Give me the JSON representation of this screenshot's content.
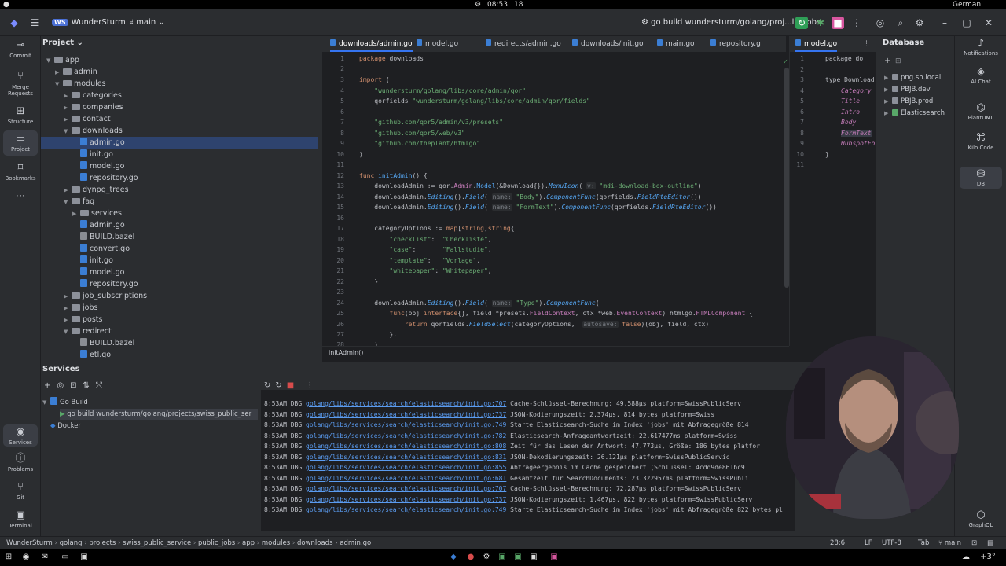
{
  "system": {
    "time": "08:53",
    "notifications": "18",
    "keyboard": "German"
  },
  "titlebar": {
    "workspace_badge": "WS",
    "project": "WunderSturm",
    "branch": "main",
    "run_config": "go build wundersturm/golang/proj...lic_jobs"
  },
  "left_stripe": [
    "Commit",
    "Merge Requests",
    "Structure",
    "Project",
    "Bookmarks",
    "Services",
    "Problems",
    "Git",
    "Terminal"
  ],
  "right_stripe": [
    "Notifications",
    "AI Chat",
    "PlantUML",
    "Kilo Code",
    "DB",
    "GraphQL"
  ],
  "project_panel": {
    "title": "Project",
    "tree": [
      {
        "label": "app",
        "type": "folder",
        "depth": 3,
        "open": true
      },
      {
        "label": "admin",
        "type": "folder",
        "depth": 4,
        "open": false
      },
      {
        "label": "modules",
        "type": "folder",
        "depth": 4,
        "open": true
      },
      {
        "label": "categories",
        "type": "folder",
        "depth": 5,
        "open": false
      },
      {
        "label": "companies",
        "type": "folder",
        "depth": 5,
        "open": false
      },
      {
        "label": "contact",
        "type": "folder",
        "depth": 5,
        "open": false
      },
      {
        "label": "downloads",
        "type": "folder",
        "depth": 5,
        "open": true
      },
      {
        "label": "admin.go",
        "type": "go",
        "depth": 6,
        "selected": true
      },
      {
        "label": "init.go",
        "type": "go",
        "depth": 6
      },
      {
        "label": "model.go",
        "type": "go",
        "depth": 6
      },
      {
        "label": "repository.go",
        "type": "go",
        "depth": 6
      },
      {
        "label": "dynpg_trees",
        "type": "folder",
        "depth": 5,
        "open": false
      },
      {
        "label": "faq",
        "type": "folder",
        "depth": 5,
        "open": true
      },
      {
        "label": "services",
        "type": "folder",
        "depth": 6,
        "open": false
      },
      {
        "label": "admin.go",
        "type": "go",
        "depth": 6
      },
      {
        "label": "BUILD.bazel",
        "type": "bazel",
        "depth": 6
      },
      {
        "label": "convert.go",
        "type": "go",
        "depth": 6
      },
      {
        "label": "init.go",
        "type": "go",
        "depth": 6
      },
      {
        "label": "model.go",
        "type": "go",
        "depth": 6
      },
      {
        "label": "repository.go",
        "type": "go",
        "depth": 6
      },
      {
        "label": "job_subscriptions",
        "type": "folder",
        "depth": 5,
        "open": false
      },
      {
        "label": "jobs",
        "type": "folder",
        "depth": 5,
        "open": false
      },
      {
        "label": "posts",
        "type": "folder",
        "depth": 5,
        "open": false
      },
      {
        "label": "redirect",
        "type": "folder",
        "depth": 5,
        "open": true
      },
      {
        "label": "BUILD.bazel",
        "type": "bazel",
        "depth": 6
      },
      {
        "label": "etl.go",
        "type": "go",
        "depth": 6
      }
    ]
  },
  "tabs": [
    "downloads/admin.go",
    "model.go",
    "redirects/admin.go",
    "downloads/init.go",
    "main.go",
    "repository.g"
  ],
  "tabs_right": [
    "model.go"
  ],
  "editor": {
    "line_numbers": [
      "1",
      "2",
      "3",
      "4",
      "5",
      "6",
      "7",
      "8",
      "9",
      "10",
      "11",
      "12",
      "13",
      "14",
      "15",
      "16",
      "17",
      "18",
      "19",
      "20",
      "21",
      "22",
      "23",
      "24",
      "25",
      "26",
      "27",
      "28"
    ],
    "function_breadcrumb": "initAdmin()"
  },
  "editor2": {
    "line_numbers": [
      "1",
      "2",
      "3",
      "4",
      "5",
      "6",
      "7",
      "8",
      "9",
      "10",
      "11"
    ],
    "lines": [
      "package do",
      "",
      "type Download",
      "Category",
      "Title",
      "Intro",
      "Body",
      "FormText",
      "HubspotFo",
      "}",
      ""
    ]
  },
  "database": {
    "title": "Database",
    "items": [
      "png.sh.local",
      "PBJB.dev",
      "PBJB.prod",
      "Elasticsearch"
    ]
  },
  "services": {
    "title": "Services",
    "tree": [
      "Go Build",
      "go build wundersturm/golang/projects/swiss_public_ser",
      "Docker"
    ],
    "log_lines": [
      {
        "time": "8:53AM",
        "lvl": "DBG",
        "src": "golang/libs/services/search/elasticsearch/init.go:707",
        "msg": "Cache-Schlüssel-Berechnung: 49.588µs platform=SwissPublicServ"
      },
      {
        "time": "8:53AM",
        "lvl": "DBG",
        "src": "golang/libs/services/search/elasticsearch/init.go:737",
        "msg": "JSON-Kodierungszeit: 2.374µs, 814 bytes platform=Swiss"
      },
      {
        "time": "8:53AM",
        "lvl": "DBG",
        "src": "golang/libs/services/search/elasticsearch/init.go:749",
        "msg": "Starte Elasticsearch-Suche im Index 'jobs' mit Abfragegröße 814"
      },
      {
        "time": "8:53AM",
        "lvl": "DBG",
        "src": "golang/libs/services/search/elasticsearch/init.go:782",
        "msg": "Elasticsearch-Anfrageantwortzeit: 22.617477ms platform=Swiss"
      },
      {
        "time": "8:53AM",
        "lvl": "DBG",
        "src": "golang/libs/services/search/elasticsearch/init.go:808",
        "msg": "Zeit für das Lesen der Antwort: 47.773µs, Größe: 186 bytes platfor"
      },
      {
        "time": "8:53AM",
        "lvl": "DBG",
        "src": "golang/libs/services/search/elasticsearch/init.go:831",
        "msg": "JSON-Dekodierungszeit: 26.121µs platform=SwissPublicServic"
      },
      {
        "time": "8:53AM",
        "lvl": "DBG",
        "src": "golang/libs/services/search/elasticsearch/init.go:855",
        "msg": "Abfrageergebnis im Cache gespeichert (Schlüssel: 4cdd9de861bc9"
      },
      {
        "time": "8:53AM",
        "lvl": "DBG",
        "src": "golang/libs/services/search/elasticsearch/init.go:681",
        "msg": "Gesamtzeit für SearchDocuments: 23.322957ms platform=SwissPubli"
      },
      {
        "time": "8:53AM",
        "lvl": "DBG",
        "src": "golang/libs/services/search/elasticsearch/init.go:707",
        "msg": "Cache-Schlüssel-Berechnung: 72.287µs platform=SwissPublicServ"
      },
      {
        "time": "8:53AM",
        "lvl": "DBG",
        "src": "golang/libs/services/search/elasticsearch/init.go:737",
        "msg": "JSON-Kodierungszeit: 1.467µs, 822 bytes platform=SwissPublicServ"
      },
      {
        "time": "8:53AM",
        "lvl": "DBG",
        "src": "golang/libs/services/search/elasticsearch/init.go:749",
        "msg": "Starte Elasticsearch-Suche im Index 'jobs' mit Abfragegröße 822 bytes pl"
      }
    ]
  },
  "statusbar": {
    "path": [
      "WunderSturm",
      "golang",
      "projects",
      "swiss_public_service",
      "public_jobs",
      "app",
      "modules",
      "downloads",
      "admin.go"
    ],
    "position": "28:6",
    "line_sep": "LF",
    "encoding": "UTF-8",
    "indent": "Tab",
    "branch": "main"
  },
  "dock": {
    "weather": "+3°"
  },
  "colors": {
    "accent": "#3574f0",
    "run": "#2f9f57",
    "stop": "#d8569f"
  }
}
